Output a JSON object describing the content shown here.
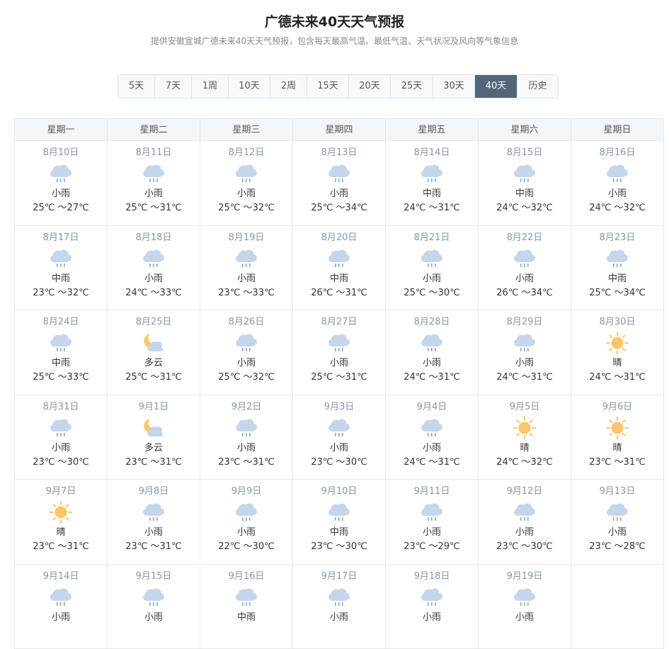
{
  "page": {
    "title": "广德未来40天天气预报",
    "subtitle": "提供安徽宣城广德未来40天天气预报，包含每天最高气温、最低气温、天气状况及风向等气象信息"
  },
  "tabs": [
    {
      "label": "5天",
      "active": false
    },
    {
      "label": "7天",
      "active": false
    },
    {
      "label": "1周",
      "active": false
    },
    {
      "label": "10天",
      "active": false
    },
    {
      "label": "2周",
      "active": false
    },
    {
      "label": "15天",
      "active": false
    },
    {
      "label": "20天",
      "active": false
    },
    {
      "label": "25天",
      "active": false
    },
    {
      "label": "30天",
      "active": false
    },
    {
      "label": "40天",
      "active": true
    },
    {
      "label": "历史",
      "active": false
    }
  ],
  "weekdays": [
    "星期一",
    "星期二",
    "星期三",
    "星期四",
    "星期五",
    "星期六",
    "星期日"
  ],
  "colors": {
    "rain_cloud": "#c5d6ea",
    "rain_drop": "#8aa6c6",
    "sun": "#ffc56b",
    "moon": "#f7c86a",
    "active_tab": "#536677"
  },
  "weeks": [
    [
      {
        "date": "8月10日",
        "icon": "rain-icon",
        "cond": "小雨",
        "temp": "25℃ ～27℃"
      },
      {
        "date": "8月11日",
        "icon": "rain-icon",
        "cond": "小雨",
        "temp": "25℃ ～31℃"
      },
      {
        "date": "8月12日",
        "icon": "rain-icon",
        "cond": "小雨",
        "temp": "25℃ ～32℃"
      },
      {
        "date": "8月13日",
        "icon": "rain-icon",
        "cond": "小雨",
        "temp": "25℃ ～34℃"
      },
      {
        "date": "8月14日",
        "icon": "rain-icon",
        "cond": "中雨",
        "temp": "24℃ ～31℃"
      },
      {
        "date": "8月15日",
        "icon": "rain-icon",
        "cond": "中雨",
        "temp": "24℃ ～32℃"
      },
      {
        "date": "8月16日",
        "icon": "rain-icon",
        "cond": "小雨",
        "temp": "24℃ ～32℃"
      }
    ],
    [
      {
        "date": "8月17日",
        "icon": "rain-icon",
        "cond": "中雨",
        "temp": "23℃ ～32℃"
      },
      {
        "date": "8月18日",
        "icon": "rain-icon",
        "cond": "小雨",
        "temp": "24℃ ～33℃"
      },
      {
        "date": "8月19日",
        "icon": "rain-icon",
        "cond": "小雨",
        "temp": "23℃ ～33℃"
      },
      {
        "date": "8月20日",
        "icon": "rain-icon",
        "cond": "中雨",
        "temp": "26℃ ～31℃"
      },
      {
        "date": "8月21日",
        "icon": "rain-icon",
        "cond": "小雨",
        "temp": "25℃ ～30℃"
      },
      {
        "date": "8月22日",
        "icon": "rain-icon",
        "cond": "小雨",
        "temp": "26℃ ～34℃"
      },
      {
        "date": "8月23日",
        "icon": "rain-icon",
        "cond": "中雨",
        "temp": "25℃ ～34℃"
      }
    ],
    [
      {
        "date": "8月24日",
        "icon": "rain-icon",
        "cond": "中雨",
        "temp": "25℃ ～33℃"
      },
      {
        "date": "8月25日",
        "icon": "partly-cloudy-night-icon",
        "cond": "多云",
        "temp": "25℃ ～31℃"
      },
      {
        "date": "8月26日",
        "icon": "rain-icon",
        "cond": "小雨",
        "temp": "25℃ ～32℃"
      },
      {
        "date": "8月27日",
        "icon": "rain-icon",
        "cond": "小雨",
        "temp": "25℃ ～31℃"
      },
      {
        "date": "8月28日",
        "icon": "rain-icon",
        "cond": "小雨",
        "temp": "24℃ ～31℃"
      },
      {
        "date": "8月29日",
        "icon": "rain-icon",
        "cond": "小雨",
        "temp": "24℃ ～31℃"
      },
      {
        "date": "8月30日",
        "icon": "sun-icon",
        "cond": "晴",
        "temp": "24℃ ～31℃"
      }
    ],
    [
      {
        "date": "8月31日",
        "icon": "rain-icon",
        "cond": "小雨",
        "temp": "23℃ ～30℃"
      },
      {
        "date": "9月1日",
        "icon": "partly-cloudy-night-icon",
        "cond": "多云",
        "temp": "23℃ ～31℃"
      },
      {
        "date": "9月2日",
        "icon": "rain-icon",
        "cond": "小雨",
        "temp": "23℃ ～31℃"
      },
      {
        "date": "9月3日",
        "icon": "rain-icon",
        "cond": "小雨",
        "temp": "23℃ ～30℃"
      },
      {
        "date": "9月4日",
        "icon": "rain-icon",
        "cond": "小雨",
        "temp": "24℃ ～31℃"
      },
      {
        "date": "9月5日",
        "icon": "sun-icon",
        "cond": "晴",
        "temp": "24℃ ～32℃"
      },
      {
        "date": "9月6日",
        "icon": "sun-icon",
        "cond": "晴",
        "temp": "23℃ ～31℃"
      }
    ],
    [
      {
        "date": "9月7日",
        "icon": "sun-icon",
        "cond": "晴",
        "temp": "23℃ ～31℃"
      },
      {
        "date": "9月8日",
        "icon": "rain-icon",
        "cond": "小雨",
        "temp": "23℃ ～31℃"
      },
      {
        "date": "9月9日",
        "icon": "rain-icon",
        "cond": "小雨",
        "temp": "22℃ ～30℃"
      },
      {
        "date": "9月10日",
        "icon": "rain-icon",
        "cond": "中雨",
        "temp": "23℃ ～30℃"
      },
      {
        "date": "9月11日",
        "icon": "rain-icon",
        "cond": "小雨",
        "temp": "23℃ ～29℃"
      },
      {
        "date": "9月12日",
        "icon": "rain-icon",
        "cond": "小雨",
        "temp": "23℃ ～30℃"
      },
      {
        "date": "9月13日",
        "icon": "rain-icon",
        "cond": "小雨",
        "temp": "23℃ ～28℃"
      }
    ],
    [
      {
        "date": "9月14日",
        "icon": "rain-icon",
        "cond": "小雨",
        "temp": ""
      },
      {
        "date": "9月15日",
        "icon": "rain-icon",
        "cond": "小雨",
        "temp": ""
      },
      {
        "date": "9月16日",
        "icon": "rain-icon",
        "cond": "中雨",
        "temp": ""
      },
      {
        "date": "9月17日",
        "icon": "rain-icon",
        "cond": "小雨",
        "temp": ""
      },
      {
        "date": "9月18日",
        "icon": "rain-icon",
        "cond": "小雨",
        "temp": ""
      },
      {
        "date": "9月19日",
        "icon": "rain-icon",
        "cond": "小雨",
        "temp": ""
      },
      null
    ]
  ]
}
